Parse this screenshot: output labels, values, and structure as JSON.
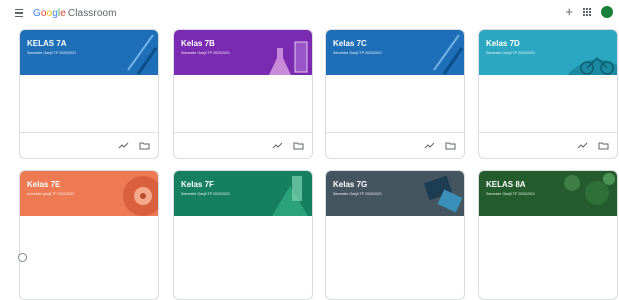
{
  "app": {
    "logo_google": [
      "G",
      "o",
      "o",
      "g",
      "l",
      "e"
    ],
    "logo_classroom": "Classroom"
  },
  "icons": {
    "menu": "menu-icon",
    "add": "plus-icon",
    "apps": "apps-icon",
    "avatar": "avatar",
    "help": "help-icon",
    "edit": "pencil-icon",
    "progress": "trend-icon",
    "folder": "folder-icon"
  },
  "colors": {
    "blue": "#1e6fb8",
    "purple": "#7b2bb1",
    "lightblue": "#2ba7c2",
    "orange": "#ee7a54",
    "green": "#16805e",
    "gray": "#455560",
    "darkgreen": "#245c2d"
  },
  "cards": [
    {
      "title": "KELAS 7A",
      "subtitle": "Semester Ganjil TP 2020/2021",
      "color": "#1e6fb8"
    },
    {
      "title": "Kelas 7B",
      "subtitle": "Semester Ganjil TP 2020/2021",
      "color": "#7b2bb1"
    },
    {
      "title": "Kelas 7C",
      "subtitle": "Semester Ganjil TP 2020/2021",
      "color": "#1e6fb8"
    },
    {
      "title": "Kelas 7D",
      "subtitle": "Semester Ganjil TP 2020/2021",
      "color": "#2ba7c2"
    },
    {
      "title": "Kelas 7E",
      "subtitle": "semester ganjil TP 2020/2021",
      "color": "#ee7a54"
    },
    {
      "title": "Kelas 7F",
      "subtitle": "Semester Ganjil TP 2020/2021",
      "color": "#16805e"
    },
    {
      "title": "Kelas 7G",
      "subtitle": "Semester Ganjil TP 2020/2021",
      "color": "#455560"
    },
    {
      "title": "KELAS 8A",
      "subtitle": "Semester Ganjil TP 2020/2021",
      "color": "#245c2d"
    }
  ]
}
